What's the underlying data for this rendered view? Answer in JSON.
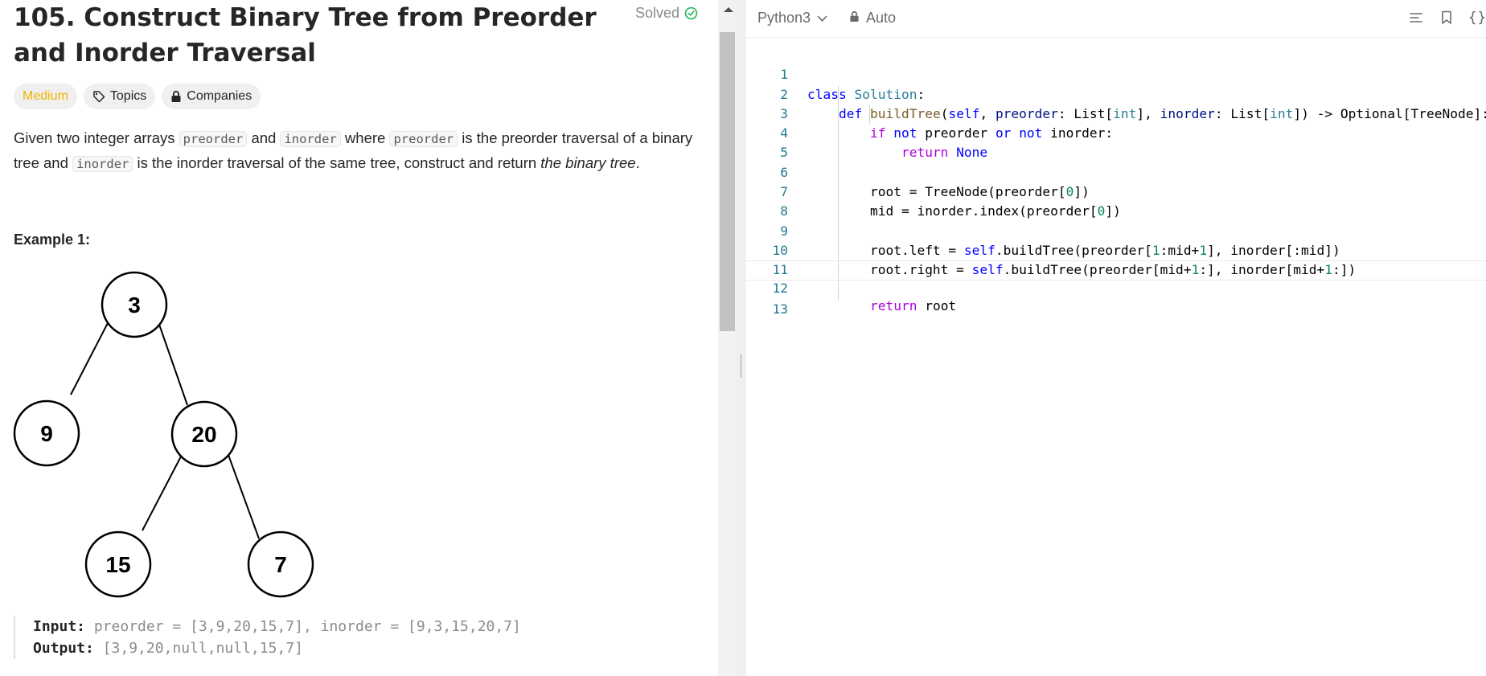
{
  "problem": {
    "title": "105. Construct Binary Tree from Preorder and Inorder Traversal",
    "solved_label": "Solved",
    "difficulty": "Medium",
    "topics_label": "Topics",
    "companies_label": "Companies",
    "description": {
      "p1": "Given two integer arrays ",
      "c1": "preorder",
      "p2": " and ",
      "c2": "inorder",
      "p3": " where ",
      "c3": "preorder",
      "p4": " is the preorder traversal of a binary tree and ",
      "c4": "inorder",
      "p5": " is the inorder traversal of the same tree, construct and return ",
      "em": "the binary tree",
      "p6": "."
    },
    "example_title": "Example 1:",
    "tree_nodes": [
      "3",
      "9",
      "20",
      "15",
      "7"
    ],
    "example": {
      "input_label": "Input:",
      "input_value": " preorder = [3,9,20,15,7], inorder = [9,3,15,20,7]",
      "output_label": "Output:",
      "output_value": " [3,9,20,null,null,15,7]"
    }
  },
  "editor": {
    "language": "Python3",
    "mode": "Auto",
    "line_numbers": [
      "1",
      "2",
      "3",
      "4",
      "5",
      "6",
      "7",
      "8",
      "9",
      "10",
      "11",
      "12",
      "13"
    ],
    "code": {
      "l1_kw": "class",
      "l1_cls": "Solution",
      "l1_rest": ":",
      "l2_kw": "def",
      "l2_fn": "buildTree",
      "l2_a": "(",
      "l2_self": "self",
      "l2_b": ", ",
      "l2_p1": "preorder",
      "l2_c": ": List[",
      "l2_t1": "int",
      "l2_d": "], ",
      "l2_p2": "inorder",
      "l2_e": ": List[",
      "l2_t2": "int",
      "l2_f": "]) -> Optional[TreeNode]:",
      "l3_if": "if",
      "l3_not1": "not",
      "l3_a": " preorder ",
      "l3_or": "or",
      "l3_not2": "not",
      "l3_b": " inorder:",
      "l4_ret": "return",
      "l4_none": "None",
      "l6_a": "root = TreeNode(preorder[",
      "l6_num": "0",
      "l6_b": "])",
      "l7_a": "mid = inorder.index(preorder[",
      "l7_num": "0",
      "l7_b": "])",
      "l9_a": "root.left = ",
      "l9_self": "self",
      "l9_b": ".buildTree(preorder[",
      "l9_n1": "1",
      "l9_c": ":mid+",
      "l9_n2": "1",
      "l9_d": "], inorder[:mid])",
      "l10_a": "root.right = ",
      "l10_self": "self",
      "l10_b": ".buildTree(preorder[mid+",
      "l10_n1": "1",
      "l10_c": ":], inorder[mid+",
      "l10_n2": "1",
      "l10_d": ":])",
      "l12_ret": "return",
      "l12_a": " root"
    }
  },
  "icons": [
    "check-circle-icon",
    "tag-icon",
    "lock-icon",
    "chevron-down-icon",
    "format-icon",
    "bookmark-icon",
    "braces-icon"
  ],
  "colors": {
    "medium": "#f0b400",
    "solved": "#2cbb5d",
    "line_numbers": "#237893"
  }
}
